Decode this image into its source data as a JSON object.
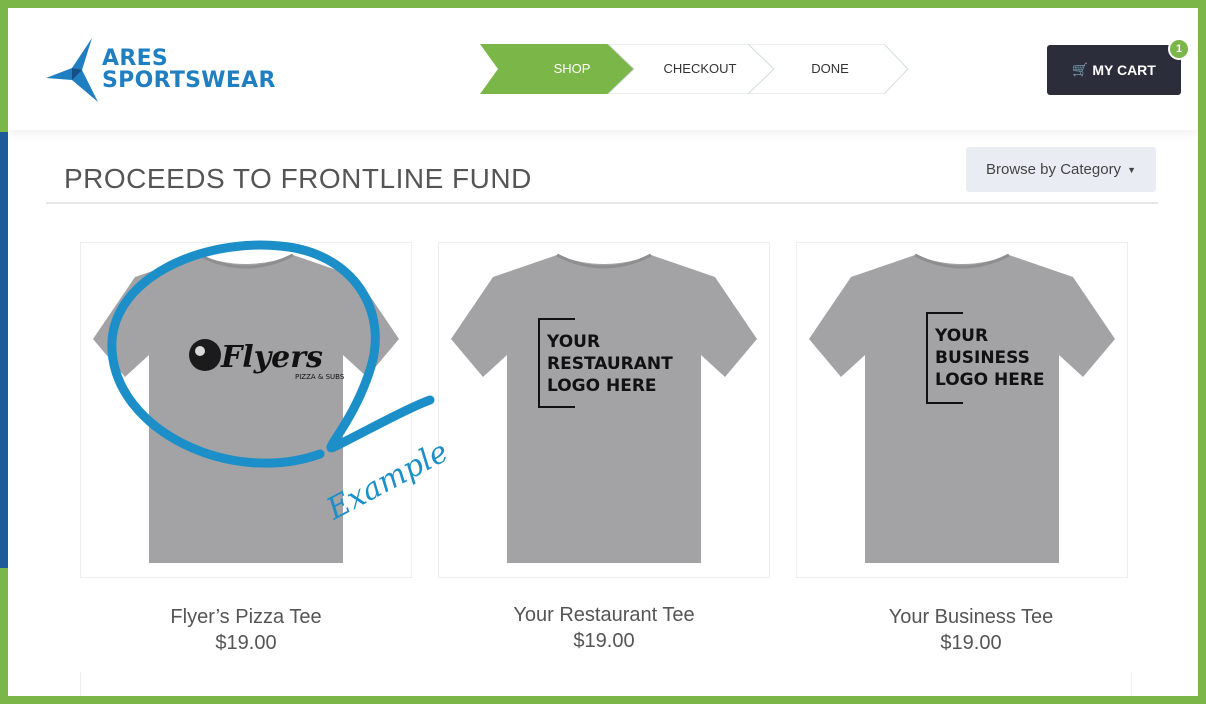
{
  "brand": {
    "line1": "ARES",
    "line2": "SPORTSWEAR",
    "color": "#1f7fc1"
  },
  "steps": [
    {
      "label": "SHOP",
      "active": true
    },
    {
      "label": "CHECKOUT",
      "active": false
    },
    {
      "label": "DONE",
      "active": false
    }
  ],
  "cart": {
    "label": "MY CART",
    "count": "1",
    "icon": "shopping-cart-icon"
  },
  "page": {
    "title": "PROCEEDS TO FRONTLINE FUND",
    "browse_label": "Browse by Category"
  },
  "products": [
    {
      "name": "Flyer’s Pizza Tee",
      "price": "$19.00",
      "logo_main": "Flyers",
      "logo_sub": "PIZZA & SUBS",
      "annotation": "Example"
    },
    {
      "name": "Your Restaurant Tee",
      "price": "$19.00",
      "placeholder": [
        "YOUR",
        "RESTAURANT",
        "LOGO HERE"
      ]
    },
    {
      "name": "Your Business Tee",
      "price": "$19.00",
      "placeholder": [
        "YOUR",
        "BUSINESS",
        "LOGO HERE"
      ]
    }
  ],
  "colors": {
    "accent_green": "#7ab648",
    "dark_button": "#2b2e3a",
    "annotation_blue": "#1d8fc8",
    "shirt_gray": "#a3a3a5"
  }
}
